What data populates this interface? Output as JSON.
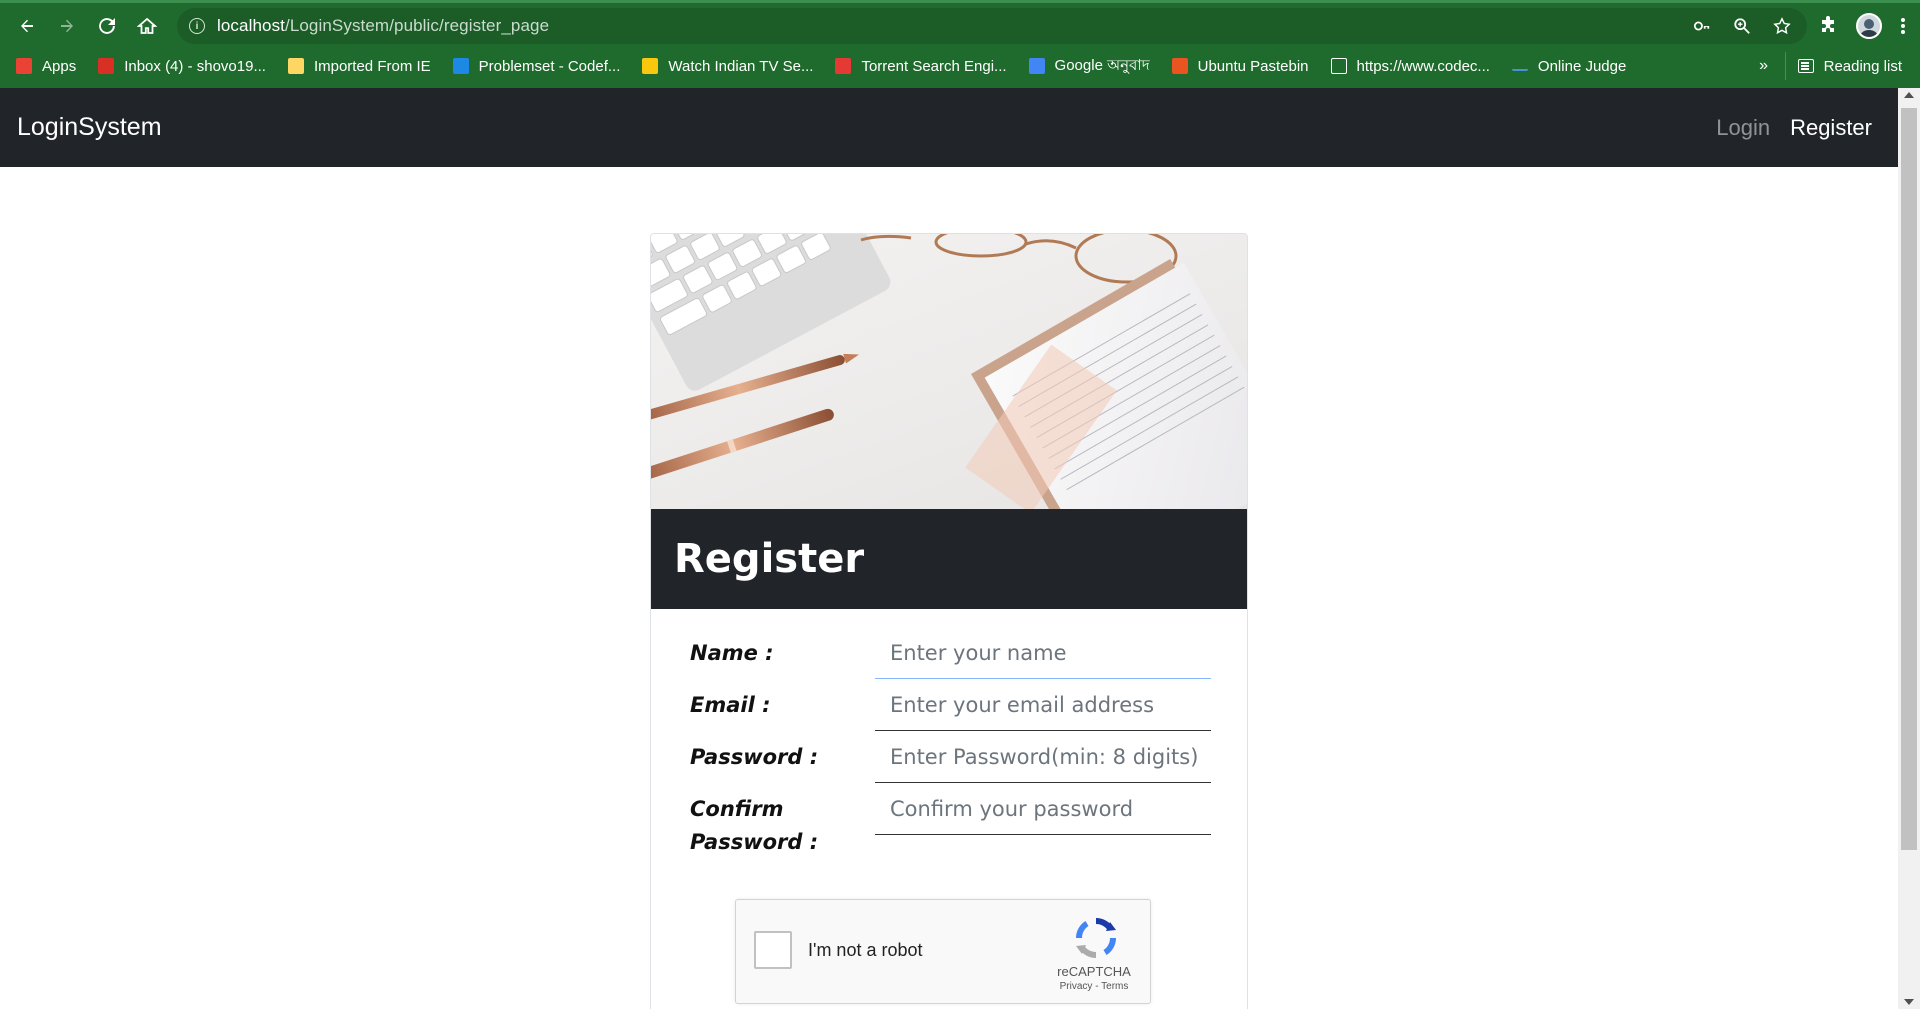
{
  "browser": {
    "url_host": "localhost",
    "url_path": "/LoginSystem/public/register_page",
    "bookmarks": [
      {
        "label": "Apps",
        "icon": "apps-grid-icon",
        "color": "#ea4335"
      },
      {
        "label": "Inbox (4) - shovo19...",
        "icon": "gmail-icon",
        "color": "#d93025"
      },
      {
        "label": "Imported From IE",
        "icon": "folder-icon",
        "color": "#fdd663"
      },
      {
        "label": "Problemset - Codef...",
        "icon": "codeforces-icon",
        "color": "#1e88e5"
      },
      {
        "label": "Watch Indian TV Se...",
        "icon": "checkmark-icon",
        "color": "#f9c80e"
      },
      {
        "label": "Torrent Search Engi...",
        "icon": "x-icon",
        "color": "#e53935"
      },
      {
        "label": "Google অনুবাদ",
        "icon": "google-translate-icon",
        "color": "#4285f4"
      },
      {
        "label": "Ubuntu Pastebin",
        "icon": "ubuntu-icon",
        "color": "#e95420"
      },
      {
        "label": "https://www.codec...",
        "icon": "codechef-icon",
        "color": "#ffffff"
      },
      {
        "label": "Online Judge",
        "icon": "online-judge-icon",
        "color": "#4a90d9"
      }
    ],
    "more_label": "»",
    "reading_list_label": "Reading list"
  },
  "app": {
    "brand": "LoginSystem",
    "nav": {
      "login": "Login",
      "register": "Register"
    }
  },
  "card": {
    "title": "Register",
    "fields": [
      {
        "label": "Name :",
        "placeholder": "Enter your name"
      },
      {
        "label": "Email :",
        "placeholder": "Enter your email address"
      },
      {
        "label": "Password :",
        "placeholder": "Enter Password(min: 8 digits)"
      },
      {
        "label": "Confirm Password :",
        "placeholder": "Confirm your password"
      }
    ],
    "captcha": {
      "label": "I'm not a robot",
      "brand": "reCAPTCHA",
      "links": "Privacy - Terms"
    }
  },
  "colors": {
    "chrome_green": "#1f6b2d",
    "navbar_dark": "#212529",
    "header_dark": "#212529"
  }
}
